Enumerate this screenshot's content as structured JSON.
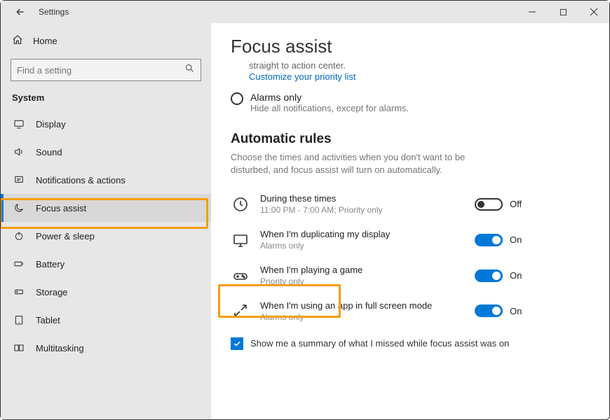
{
  "window": {
    "title": "Settings"
  },
  "sidebar": {
    "home": "Home",
    "search_placeholder": "Find a setting",
    "category": "System",
    "items": [
      {
        "label": "Display"
      },
      {
        "label": "Sound"
      },
      {
        "label": "Notifications & actions"
      },
      {
        "label": "Focus assist"
      },
      {
        "label": "Power & sleep"
      },
      {
        "label": "Battery"
      },
      {
        "label": "Storage"
      },
      {
        "label": "Tablet"
      },
      {
        "label": "Multitasking"
      }
    ],
    "active_index": 3
  },
  "main": {
    "title": "Focus assist",
    "truncated_line": "straight to action center.",
    "priority_link": "Customize your priority list",
    "radio": {
      "label": "Alarms only",
      "sub": "Hide all notifications, except for alarms."
    },
    "rules": {
      "heading": "Automatic rules",
      "desc": "Choose the times and activities when you don't want to be disturbed, and focus assist will turn on automatically.",
      "items": [
        {
          "title": "During these times",
          "sub": "11:00 PM - 7:00 AM; Priority only",
          "state": "Off",
          "on": false
        },
        {
          "title": "When I'm duplicating my display",
          "sub": "Alarms only",
          "state": "On",
          "on": true
        },
        {
          "title": "When I'm playing a game",
          "sub": "Priority only",
          "state": "On",
          "on": true
        },
        {
          "title": "When I'm using an app in full screen mode",
          "sub": "Alarms only",
          "state": "On",
          "on": true
        }
      ]
    },
    "summary_checkbox": "Show me a summary of what I missed while focus assist was on"
  }
}
